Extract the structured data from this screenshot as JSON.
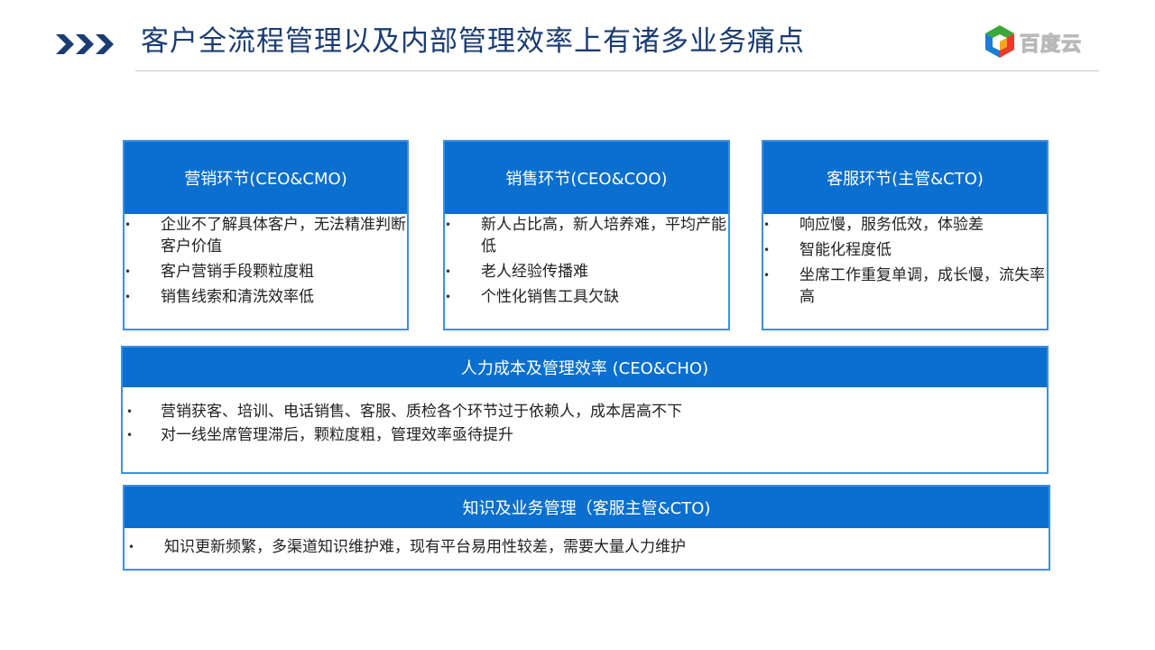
{
  "header": {
    "title": "客户全流程管理以及内部管理效率上有诸多业务痛点",
    "logo_text": "百度云"
  },
  "colors": {
    "header_blue": "#0a6fce",
    "border_blue": "#3d8fe3",
    "title_navy": "#1a3c73"
  },
  "bullet_symbol": "•",
  "panels": [
    {
      "title": "营销环节(CEO&CMO)",
      "items": [
        "企业不了解具体客户，无法精准判断客户价值",
        "客户营销手段颗粒度粗",
        "销售线索和清洗效率低"
      ]
    },
    {
      "title": "销售环节(CEO&COO)",
      "items": [
        "新人占比高，新人培养难，平均产能低",
        "老人经验传播难",
        "个性化销售工具欠缺"
      ]
    },
    {
      "title": "客服环节(主管&CTO)",
      "items": [
        "响应慢，服务低效，体验差",
        "智能化程度低",
        "坐席工作重复单调，成长慢，流失率高"
      ]
    },
    {
      "title": "人力成本及管理效率 (CEO&CHO)",
      "items": [
        "营销获客、培训、电话销售、客服、质检各个环节过于依赖人，成本居高不下",
        "对一线坐席管理滞后，颗粒度粗，管理效率亟待提升"
      ]
    },
    {
      "title": "知识及业务管理（客服主管&CTO)",
      "items": [
        "知识更新频繁，多渠道知识维护难，现有平台易用性较差，需要大量人力维护"
      ]
    }
  ]
}
